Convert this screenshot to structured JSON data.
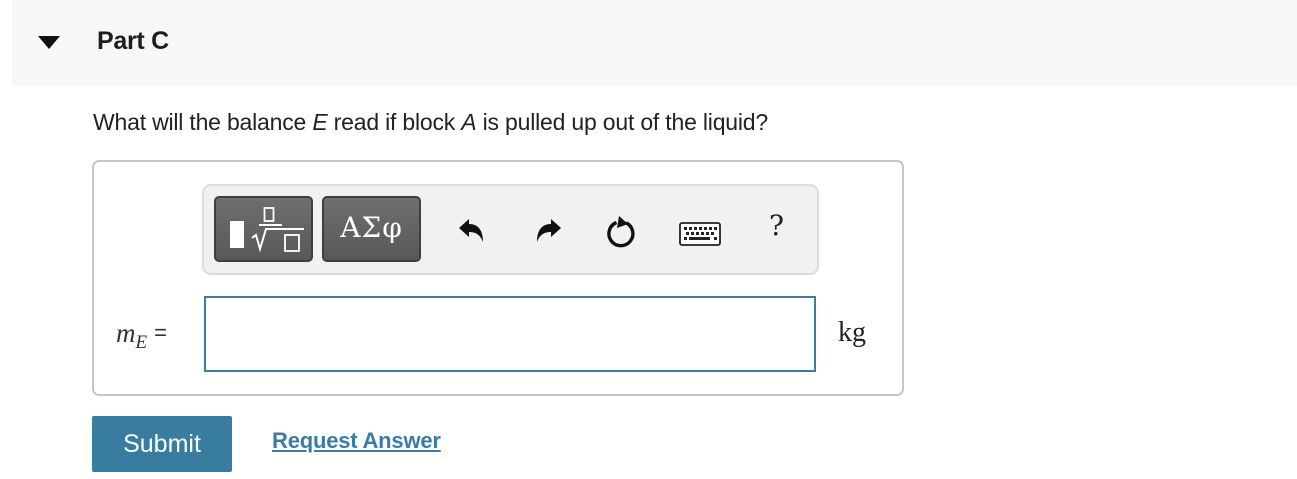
{
  "part": {
    "title": "Part C",
    "expanded": true
  },
  "question": {
    "prefix": "What will the balance ",
    "var1": "E",
    "mid": " read if block ",
    "var2": "A",
    "suffix": " is pulled up out of the liquid?"
  },
  "toolbar": {
    "templates_icon": "fraction-radical-template-icon",
    "symbols_label": "ΑΣφ",
    "undo_icon": "undo-arrow-icon",
    "redo_icon": "redo-arrow-icon",
    "reset_icon": "reset-circular-arrow-icon",
    "keyboard_icon": "keyboard-icon",
    "help_label": "?"
  },
  "answer": {
    "label_var": "m",
    "label_sub": "E",
    "label_eq": "=",
    "value": "",
    "unit": "kg"
  },
  "actions": {
    "submit_label": "Submit",
    "request_answer_label": "Request Answer"
  },
  "colors": {
    "header_bg": "#f7f7f7",
    "input_border": "#3f7ca3",
    "submit_bg": "#387c9f",
    "link": "#3a7ca5"
  }
}
